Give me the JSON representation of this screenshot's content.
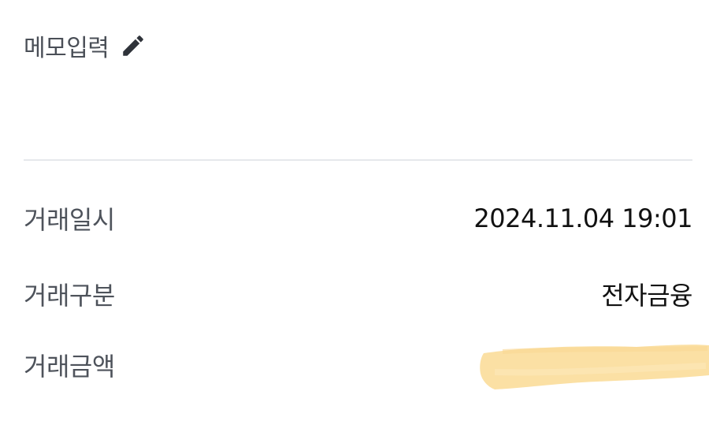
{
  "memo": {
    "label": "메모입력",
    "icon": "pencil-icon"
  },
  "details": {
    "datetime": {
      "label": "거래일시",
      "value": "2024.11.04 19:01"
    },
    "type": {
      "label": "거래구분",
      "value": "전자금융"
    },
    "amount": {
      "label": "거래금액",
      "value": ""
    }
  },
  "colors": {
    "label": "#4e535b",
    "value": "#111111",
    "divider": "#e6e8ec",
    "redaction": "#fbe0a4"
  }
}
